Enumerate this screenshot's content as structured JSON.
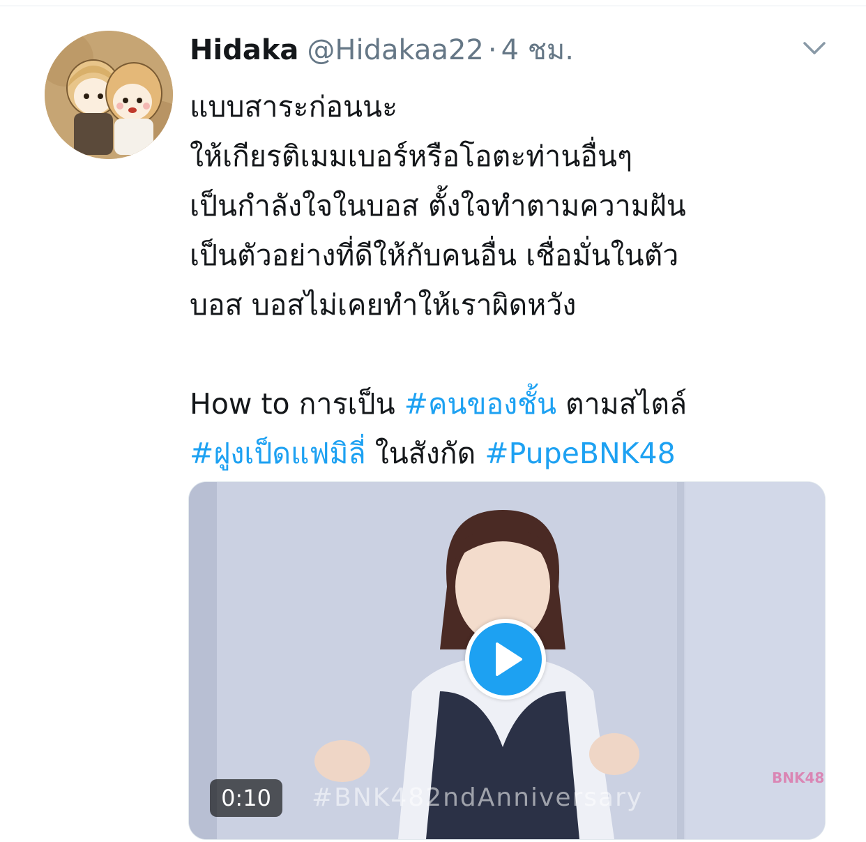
{
  "tweet": {
    "author": {
      "display_name": "Hidaka",
      "handle": "@Hidakaa22",
      "separator": "·",
      "time": "4 ชม."
    },
    "menu_icon": "chevron-down-icon",
    "lines": {
      "l1": "แบบสาระก่อนนะ",
      "l2": "ให้เกียรติเมมเบอร์หรือโอตะท่านอื่นๆ",
      "l3": "เป็นกำลังใจในบอส ตั้งใจทำตามความฝัน",
      "l4": "เป็นตัวอย่างที่ดีให้กับคนอื่น เชื่อมั่นในตัว",
      "l5": "บอส บอสไม่เคยทำให้เราผิดหวัง"
    },
    "line6": {
      "prefix": "How to การเป็น ",
      "hashtag1": "#คนของชั้น",
      "middle": " ตามสไตล์"
    },
    "line7": {
      "hashtag2": "#ฝูงเป็ดแฟมิลี่",
      "middle": " ในสังกัด ",
      "hashtag3": "#PupeBNK48"
    },
    "hashtag_color": "#1da1f2",
    "video": {
      "duration": "0:10",
      "watermark": "#BNK482ndAnniversary",
      "corner_logo": "BNK48",
      "play_icon": "play-icon"
    }
  }
}
